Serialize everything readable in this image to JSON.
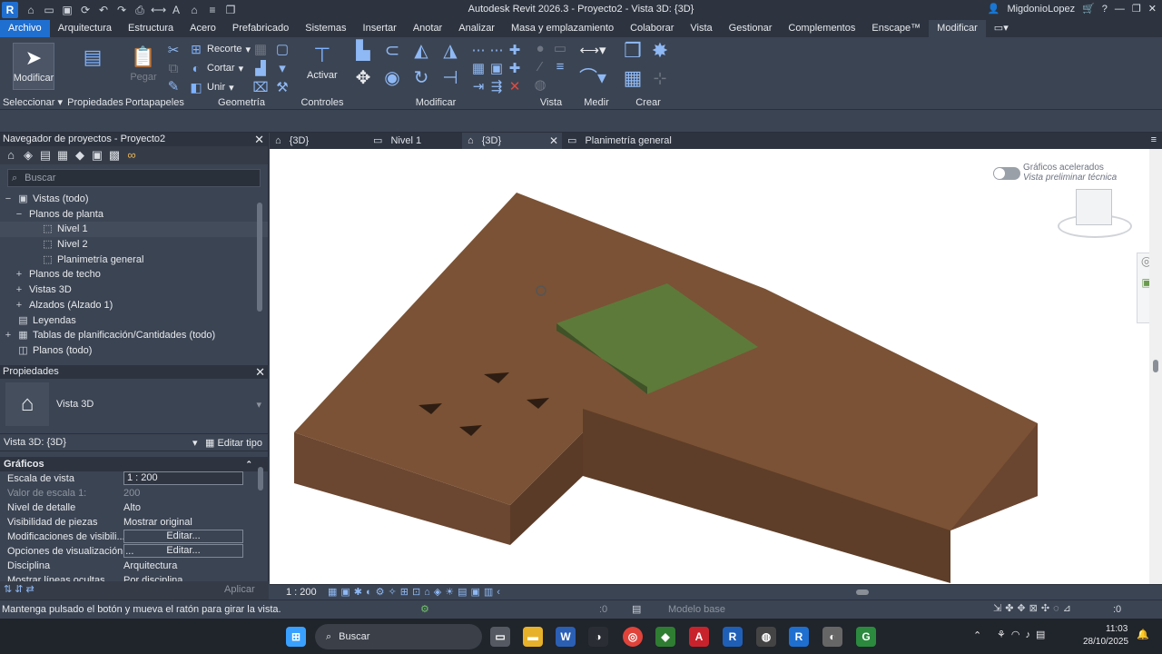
{
  "app": {
    "logo": "R",
    "window_title": "Autodesk Revit 2026.3 - Proyecto2 - Vista 3D: {3D}",
    "user": "MigdonioLopez"
  },
  "menu": [
    "Archivo",
    "Arquitectura",
    "Estructura",
    "Acero",
    "Prefabricado",
    "Sistemas",
    "Insertar",
    "Anotar",
    "Analizar",
    "Masa y emplazamiento",
    "Colaborar",
    "Vista",
    "Gestionar",
    "Complementos",
    "Enscape™",
    "Modificar"
  ],
  "ribbon": {
    "modificar_btn": "Modificar",
    "propiedades_btn": "Propiedades",
    "pegar_btn": "Pegar",
    "recorte": "Recorte",
    "cortar": "Cortar",
    "unir": "Unir",
    "activar": "Activar",
    "panels": {
      "seleccionar": "Seleccionar",
      "propiedades": "Propiedades",
      "portapapeles": "Portapapeles",
      "geometria": "Geometría",
      "controles": "Controles",
      "modificar": "Modificar",
      "vista": "Vista",
      "medir": "Medir",
      "crear": "Crear"
    }
  },
  "navigator": {
    "title": "Navegador de proyectos - Proyecto2",
    "search_placeholder": "Buscar",
    "items": [
      {
        "label": "Vistas (todo)",
        "exp": "−",
        "icon": "views-icon"
      },
      {
        "label": "Planos de planta",
        "exp": "−",
        "icon": ""
      },
      {
        "label": "Nivel 1",
        "exp": "",
        "icon": "floorplan-icon"
      },
      {
        "label": "Nivel 2",
        "exp": "",
        "icon": "floorplan-icon"
      },
      {
        "label": "Planimetría general",
        "exp": "",
        "icon": "floorplan-icon"
      },
      {
        "label": "Planos de techo",
        "exp": "+",
        "icon": ""
      },
      {
        "label": "Vistas 3D",
        "exp": "+",
        "icon": ""
      },
      {
        "label": "Alzados (Alzado 1)",
        "exp": "+",
        "icon": ""
      },
      {
        "label": "Leyendas",
        "exp": "",
        "icon": "legend-icon"
      },
      {
        "label": "Tablas de planificación/Cantidades (todo)",
        "exp": "+",
        "icon": "schedule-icon"
      },
      {
        "label": "Planos (todo)",
        "exp": "",
        "icon": "sheets-icon"
      }
    ]
  },
  "properties": {
    "title": "Propiedades",
    "type_name": "Vista 3D",
    "instance": "Vista 3D: {3D}",
    "edit_type": "Editar tipo",
    "section": "Gráficos",
    "rows": [
      {
        "k": "Escala de vista",
        "v": "1 : 200",
        "style": "box"
      },
      {
        "k": "Valor de escala    1:",
        "v": "200",
        "style": "dim"
      },
      {
        "k": "Nivel de detalle",
        "v": "Alto",
        "style": ""
      },
      {
        "k": "Visibilidad de piezas",
        "v": "Mostrar original",
        "style": ""
      },
      {
        "k": "Modificaciones de visibili...",
        "v": "Editar...",
        "style": "btn"
      },
      {
        "k": "Opciones de visualización ...",
        "v": "Editar...",
        "style": "btn"
      },
      {
        "k": "Disciplina",
        "v": "Arquitectura",
        "style": ""
      },
      {
        "k": "Mostrar líneas ocultas",
        "v": "Por disciplina",
        "style": ""
      }
    ],
    "apply": "Aplicar"
  },
  "view_tabs": [
    {
      "label": "{3D}",
      "active": false,
      "icon": "home-icon"
    },
    {
      "label": "Nivel 1",
      "active": false,
      "icon": "floorplan-icon"
    },
    {
      "label": "{3D}",
      "active": true,
      "icon": "home-icon"
    },
    {
      "label": "Planimetría general",
      "active": false,
      "icon": "floorplan-icon"
    }
  ],
  "canvas": {
    "accel_label": "Gráficos acelerados",
    "accel_sub": "Vista preliminar técnica"
  },
  "viewbar": {
    "scale": "1 : 200"
  },
  "status": {
    "hint": "Mantenga pulsado el botón y mueva el ratón para girar la vista.",
    "count_a": ":0",
    "model": "Modelo base",
    "count_b": ":0"
  },
  "taskbar": {
    "search": "Buscar",
    "time": "11:03",
    "date": "28/10/2025"
  },
  "colors": {
    "terrain": "#7b5235",
    "terrain_side": "#5e3e28",
    "pad": "#5d7a3a",
    "accent": "#1f6fd1"
  }
}
